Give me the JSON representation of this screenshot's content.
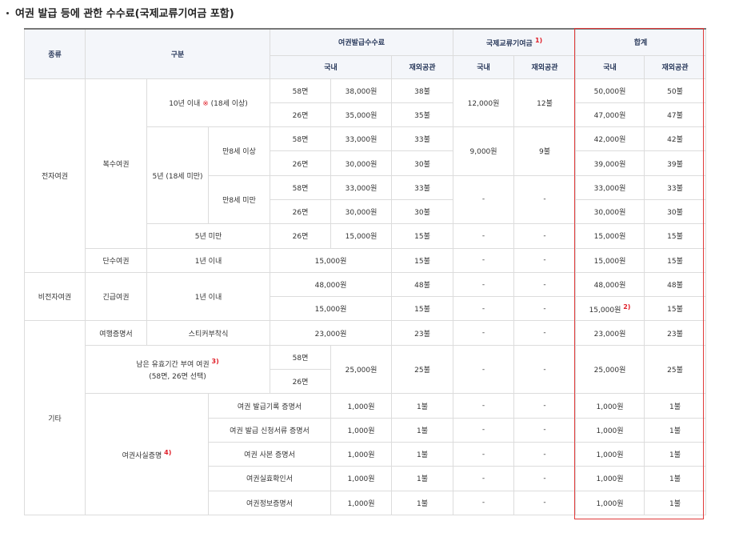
{
  "title": "여권 발급 등에 관한 수수료(국제교류기여금 포함)",
  "header": {
    "type": "종류",
    "category": "구분",
    "issue_fee": "여권발급수수료",
    "intl_contribution": "국제교류기여금",
    "intl_note": "1)",
    "total": "합계",
    "domestic": "국내",
    "overseas": "재외공관"
  },
  "groups": {
    "electronic": "전자여권",
    "multiple": "복수여권",
    "ten_year": "10년 이내",
    "ten_year_mark": "※",
    "ten_year_age": "(18세 이상)",
    "five_year": "5년 (18세 미만)",
    "age8_over": "만8세 이상",
    "age8_under": "만8세 미만",
    "under5": "5년 미만",
    "single": "단수여권",
    "within1": "1년 이내",
    "non_electronic": "비전자여권",
    "emergency": "긴급여권",
    "etc": "기타",
    "travel_cert": "여행증명서",
    "sticker": "스티커부착식",
    "remaining_line1": "남은 유효기간 부여 여권",
    "remaining_note": "3)",
    "remaining_line2": "(58면, 26면 선택)",
    "fact_cert": "여권사실증명",
    "fact_note": "4)",
    "total_note": "2)"
  },
  "rows": {
    "r1": {
      "pages": "58면",
      "fee": "38,000원",
      "ov": "38불",
      "ic_dom": "12,000원",
      "ic_ov": "12불",
      "tot_dom": "50,000원",
      "tot_ov": "50불"
    },
    "r2": {
      "pages": "26면",
      "fee": "35,000원",
      "ov": "35불",
      "tot_dom": "47,000원",
      "tot_ov": "47불"
    },
    "r3": {
      "pages": "58면",
      "fee": "33,000원",
      "ov": "33불",
      "ic_dom": "9,000원",
      "ic_ov": "9불",
      "tot_dom": "42,000원",
      "tot_ov": "42불"
    },
    "r4": {
      "pages": "26면",
      "fee": "30,000원",
      "ov": "30불",
      "tot_dom": "39,000원",
      "tot_ov": "39불"
    },
    "r5": {
      "pages": "58면",
      "fee": "33,000원",
      "ov": "33불",
      "ic_dom": "-",
      "ic_ov": "-",
      "tot_dom": "33,000원",
      "tot_ov": "33불"
    },
    "r6": {
      "pages": "26면",
      "fee": "30,000원",
      "ov": "30불",
      "tot_dom": "30,000원",
      "tot_ov": "30불"
    },
    "r7": {
      "pages": "26면",
      "fee": "15,000원",
      "ov": "15불",
      "ic_dom": "-",
      "ic_ov": "-",
      "tot_dom": "15,000원",
      "tot_ov": "15불"
    },
    "r8": {
      "fee": "15,000원",
      "ov": "15불",
      "ic_dom": "-",
      "ic_ov": "-",
      "tot_dom": "15,000원",
      "tot_ov": "15불"
    },
    "r9": {
      "fee": "48,000원",
      "ov": "48불",
      "ic_dom": "-",
      "ic_ov": "-",
      "tot_dom": "48,000원",
      "tot_ov": "48불"
    },
    "r10": {
      "fee": "15,000원",
      "ov": "15불",
      "ic_dom": "-",
      "ic_ov": "-",
      "tot_dom": "15,000원",
      "tot_ov": "15불"
    },
    "r11": {
      "fee": "23,000원",
      "ov": "23불",
      "ic_dom": "-",
      "ic_ov": "-",
      "tot_dom": "23,000원",
      "tot_ov": "23불"
    },
    "r12": {
      "p1": "58면",
      "p2": "26면",
      "fee": "25,000원",
      "ov": "25불",
      "ic_dom": "-",
      "ic_ov": "-",
      "tot_dom": "25,000원",
      "tot_ov": "25불"
    },
    "c1": {
      "name": "여권 발급기록 증명서",
      "fee": "1,000원",
      "ov": "1불",
      "ic_dom": "-",
      "ic_ov": "-",
      "tot_dom": "1,000원",
      "tot_ov": "1불"
    },
    "c2": {
      "name": "여권 발급 신청서류 증명서",
      "fee": "1,000원",
      "ov": "1불",
      "ic_dom": "-",
      "ic_ov": "-",
      "tot_dom": "1,000원",
      "tot_ov": "1불"
    },
    "c3": {
      "name": "여권 사본 증명서",
      "fee": "1,000원",
      "ov": "1불",
      "ic_dom": "-",
      "ic_ov": "-",
      "tot_dom": "1,000원",
      "tot_ov": "1불"
    },
    "c4": {
      "name": "여권실효확인서",
      "fee": "1,000원",
      "ov": "1불",
      "ic_dom": "-",
      "ic_ov": "-",
      "tot_dom": "1,000원",
      "tot_ov": "1불"
    },
    "c5": {
      "name": "여권정보증명서",
      "fee": "1,000원",
      "ov": "1불",
      "ic_dom": "-",
      "ic_ov": "-",
      "tot_dom": "1,000원",
      "tot_ov": "1불"
    }
  }
}
